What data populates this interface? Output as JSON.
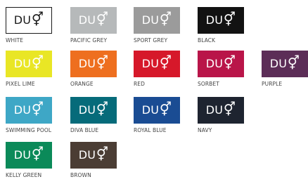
{
  "logo": {
    "text": "DU",
    "symbol": "⚥"
  },
  "swatches": [
    {
      "name": "WHITE",
      "color": "#ffffff",
      "text_color": "#1a1a1a",
      "border": true
    },
    {
      "name": "PACIFIC GREY",
      "color": "#b6b9ba",
      "text_color": "#ffffff"
    },
    {
      "name": "SPORT GREY",
      "color": "#9b9b9b",
      "text_color": "#ffffff"
    },
    {
      "name": "BLACK",
      "color": "#121212",
      "text_color": "#ffffff"
    },
    {
      "name": "PIXEL LIME",
      "color": "#e9e625",
      "text_color": "#ffffff"
    },
    {
      "name": "ORANGE",
      "color": "#ee6f1f",
      "text_color": "#ffffff"
    },
    {
      "name": "RED",
      "color": "#d6182a",
      "text_color": "#ffffff"
    },
    {
      "name": "SORBET",
      "color": "#b91549",
      "text_color": "#ffffff"
    },
    {
      "name": "PURPLE",
      "color": "#5c2d57",
      "text_color": "#ffffff"
    },
    {
      "name": "SWIMMING POOL",
      "color": "#3ea7c6",
      "text_color": "#ffffff"
    },
    {
      "name": "DIVA BLUE",
      "color": "#066b7a",
      "text_color": "#ffffff"
    },
    {
      "name": "ROYAL BLUE",
      "color": "#1a4c93",
      "text_color": "#ffffff"
    },
    {
      "name": "NAVY",
      "color": "#1e2430",
      "text_color": "#ffffff"
    },
    {
      "name": "KELLY GREEN",
      "color": "#0b8a59",
      "text_color": "#ffffff"
    },
    {
      "name": "BROWN",
      "color": "#4b3d34",
      "text_color": "#ffffff"
    }
  ]
}
